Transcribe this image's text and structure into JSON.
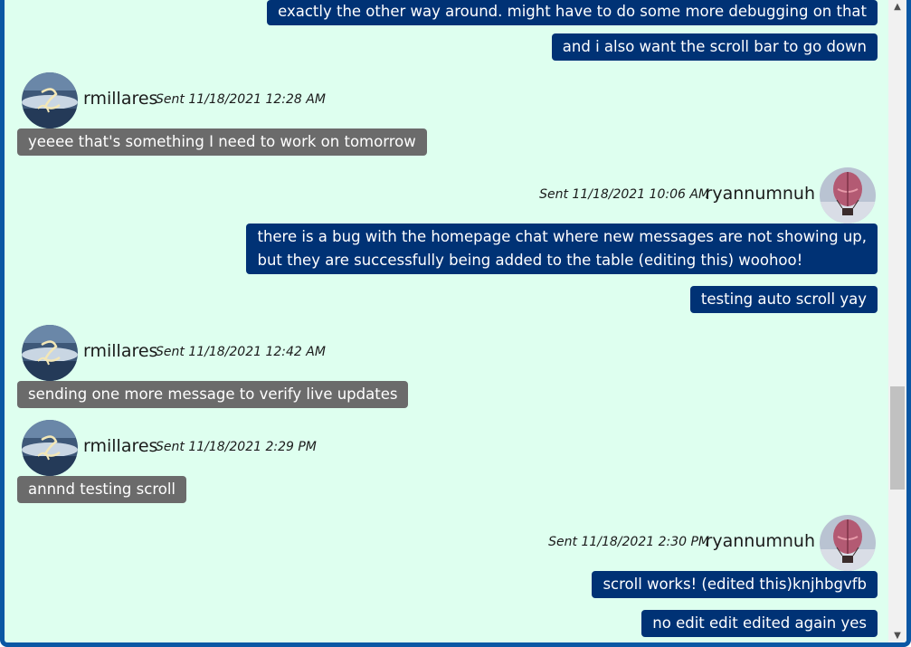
{
  "messages": [
    {
      "type": "out",
      "text": "exactly the other way around. might have to do some more debugging on that"
    },
    {
      "type": "out",
      "text": "and i also want the scroll bar to go down"
    },
    {
      "type": "in_header",
      "user": "rmillares",
      "sent": "Sent 11/18/2021 12:28 AM"
    },
    {
      "type": "in",
      "text": "yeeee that's something I need to work on tomorrow"
    },
    {
      "type": "out_header",
      "user": "ryannumnuh",
      "sent": "Sent 11/18/2021 10:06 AM"
    },
    {
      "type": "out",
      "line1": "there is a bug with the homepage chat where new messages are not showing up,",
      "line2": "but they are successfully being added to the table (editing this) woohoo!"
    },
    {
      "type": "out",
      "text": "testing auto scroll yay"
    },
    {
      "type": "in_header",
      "user": "rmillares",
      "sent": "Sent 11/18/2021 12:42 AM"
    },
    {
      "type": "in",
      "text": "sending one more message to verify live updates"
    },
    {
      "type": "in_header",
      "user": "rmillares",
      "sent": "Sent 11/18/2021 2:29 PM"
    },
    {
      "type": "in",
      "text": "annnd testing scroll"
    },
    {
      "type": "out_header",
      "user": "ryannumnuh",
      "sent": "Sent 11/18/2021 2:30 PM"
    },
    {
      "type": "out",
      "text": "scroll works! (edited this)knjhbgvfb"
    },
    {
      "type": "out",
      "text": "no edit edit edited again yes"
    }
  ],
  "scrollbar": {
    "up_icon": "chevron-up-icon",
    "down_icon": "chevron-down-icon",
    "up_glyph": "▲",
    "down_glyph": "▼"
  },
  "colors": {
    "background": "#deffef",
    "frame": "#0b57a4",
    "outgoing_bubble": "#003275",
    "incoming_bubble": "#6b6b6b"
  }
}
